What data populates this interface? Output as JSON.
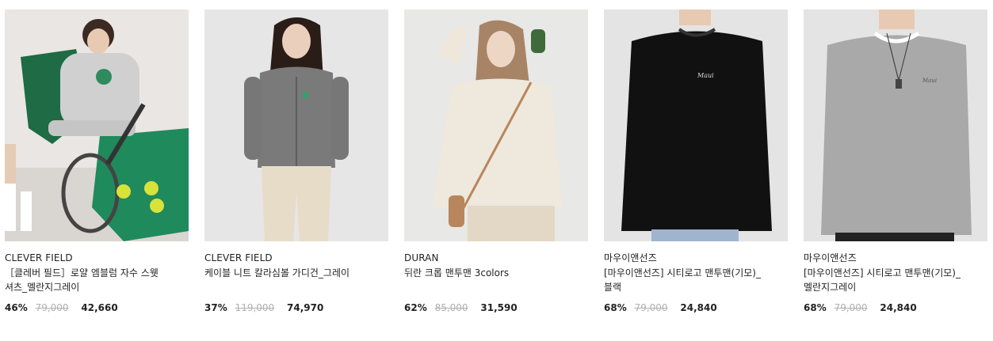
{
  "products": [
    {
      "brand": "CLEVER FIELD",
      "title": "［클레버 필드］로얄 엠블럼 자수 스웻 셔츠_멜란지그레이",
      "discount": "46%",
      "original_price": "79,000",
      "sale_price": "42,660",
      "image_icon": "product-photo"
    },
    {
      "brand": "CLEVER FIELD",
      "title": "케이블 니트 칼라심볼 가디건_그레이",
      "discount": "37%",
      "original_price": "119,000",
      "sale_price": "74,970",
      "image_icon": "product-photo"
    },
    {
      "brand": "DURAN",
      "title": "뒤란 크롭 맨투맨 3colors",
      "discount": "62%",
      "original_price": "85,000",
      "sale_price": "31,590",
      "image_icon": "product-photo"
    },
    {
      "brand": "마우이앤선즈",
      "title": "[마우이앤선즈] 시티로고 맨투맨(기모)_블랙",
      "discount": "68%",
      "original_price": "79,000",
      "sale_price": "24,840",
      "image_icon": "product-photo"
    },
    {
      "brand": "마우이앤선즈",
      "title": "[마우이앤선즈] 시티로고 맨투맨(기모)_멜란지그레이",
      "discount": "68%",
      "original_price": "79,000",
      "sale_price": "24,840",
      "image_icon": "product-photo"
    }
  ],
  "colors": {
    "text": "#222222",
    "strike": "#b0b0b0",
    "accent_green": "#1f7a4a"
  }
}
